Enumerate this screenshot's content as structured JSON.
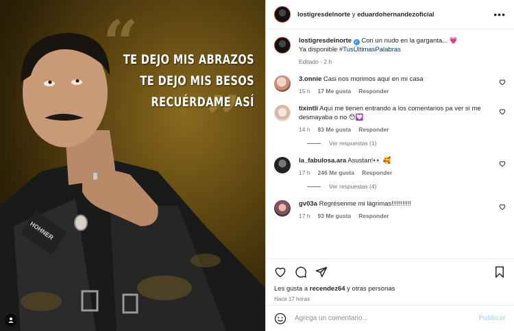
{
  "post_image": {
    "lines": [
      "Te dejo mis abrazos",
      "te dejo mis besos",
      "Recuérdame así"
    ],
    "shirt_text": "HOHNER"
  },
  "header": {
    "account": "lostigresdelnorte",
    "connector": "y",
    "coauthor": "eduardohernandezoficial",
    "more_icon": "more-horizontal-icon"
  },
  "caption": {
    "username": "lostigresdelnorte",
    "text": "Con un nudo en la garganta... 💗",
    "line2_text": "Ya disponible",
    "hashtag": "#TusÚltimasPalabras",
    "edited": "Editado · 2 h"
  },
  "comments": [
    {
      "username": "3.onnie",
      "text": "Casi nos morimos aquí en mi casa",
      "time": "15 h",
      "likes": "17 Me gusta",
      "reply": "Responder"
    },
    {
      "username": "tixintli",
      "text": "Aquí me tienen entrando a los comentarios pa ver si me desmayaba o no 😯💟",
      "time": "14 h",
      "likes": "83 Me gusta",
      "reply": "Responder",
      "view_replies": "Ver respuestas (1)"
    },
    {
      "username": "la_fabulosa.ara",
      "text": "Asustan!👀 🥰",
      "time": "17 h",
      "likes": "246 Me gusta",
      "reply": "Responder",
      "view_replies": "Ver respuestas (4)"
    },
    {
      "username": "gv03a",
      "text": "Regrésenme mi lágrimas!!!!!!!!!!!",
      "time": "17 h",
      "likes": "93 Me gusta",
      "reply": "Responder"
    }
  ],
  "actions": {
    "likes_prefix": "Les gusta a",
    "liked_by": "recendez64",
    "likes_suffix": "y otras personas",
    "timestamp": "Hace 17 horas"
  },
  "comment_box": {
    "placeholder": "Agrega un comentario...",
    "publish": "Publicar"
  },
  "colors": {
    "link": "#00376b",
    "verified": "#3897f0",
    "publish_disabled": "#b2dffc",
    "secondary_text": "#737373"
  }
}
